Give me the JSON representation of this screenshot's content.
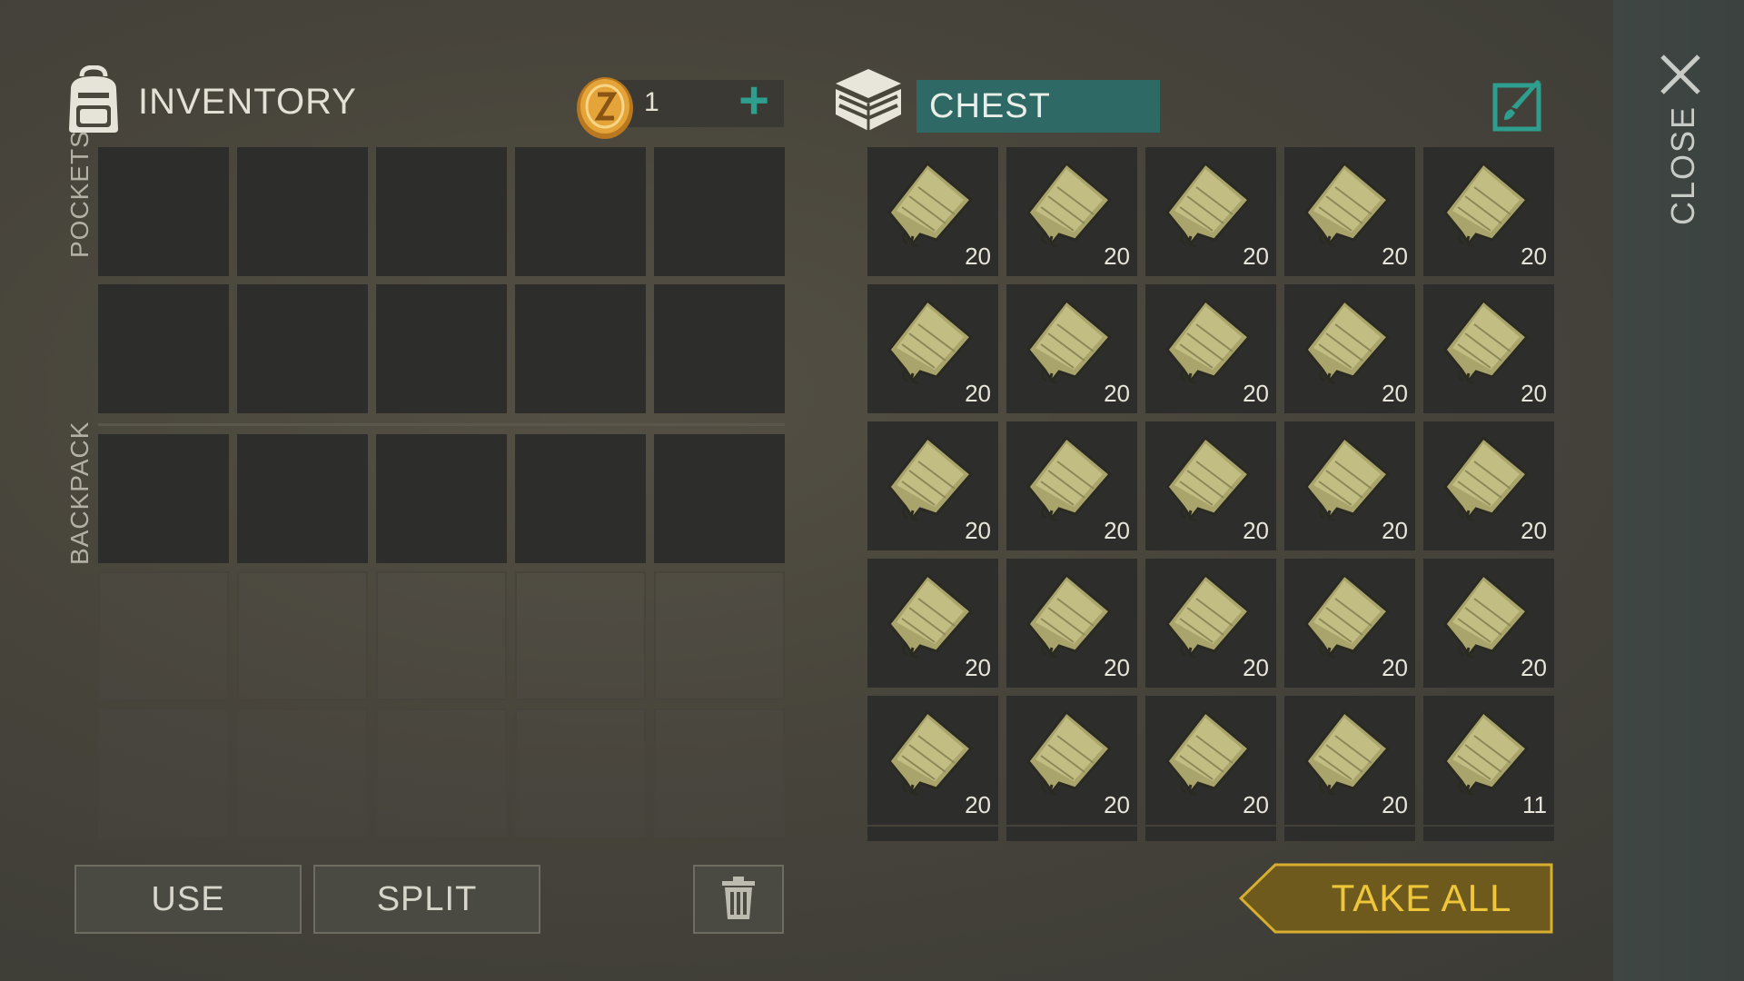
{
  "inventory": {
    "title": "INVENTORY",
    "icon": "backpack-icon",
    "coins": "1",
    "add_label": "+",
    "pockets_label": "POCKETS",
    "backpack_label": "BACKPACK"
  },
  "chest": {
    "title": "CHEST",
    "icon": "crate-icon",
    "rename_icon": "edit-brush-icon",
    "item_icon": "cloth-scrap-icon",
    "items": [
      "20",
      "20",
      "20",
      "20",
      "20",
      "20",
      "20",
      "20",
      "20",
      "20",
      "20",
      "20",
      "20",
      "20",
      "20",
      "20",
      "20",
      "20",
      "20",
      "20",
      "20",
      "20",
      "20",
      "20",
      "11"
    ]
  },
  "buttons": {
    "use": "USE",
    "split": "SPLIT",
    "delete_icon": "trash-icon",
    "take_all": "TAKE ALL"
  },
  "close": {
    "label": "CLOSE",
    "icon": "close-icon"
  },
  "colors": {
    "teal": "#2f6965",
    "accent_plus": "#2e9e8e",
    "gold": "#efc63a",
    "gold_btn": "#6d5a1c"
  }
}
